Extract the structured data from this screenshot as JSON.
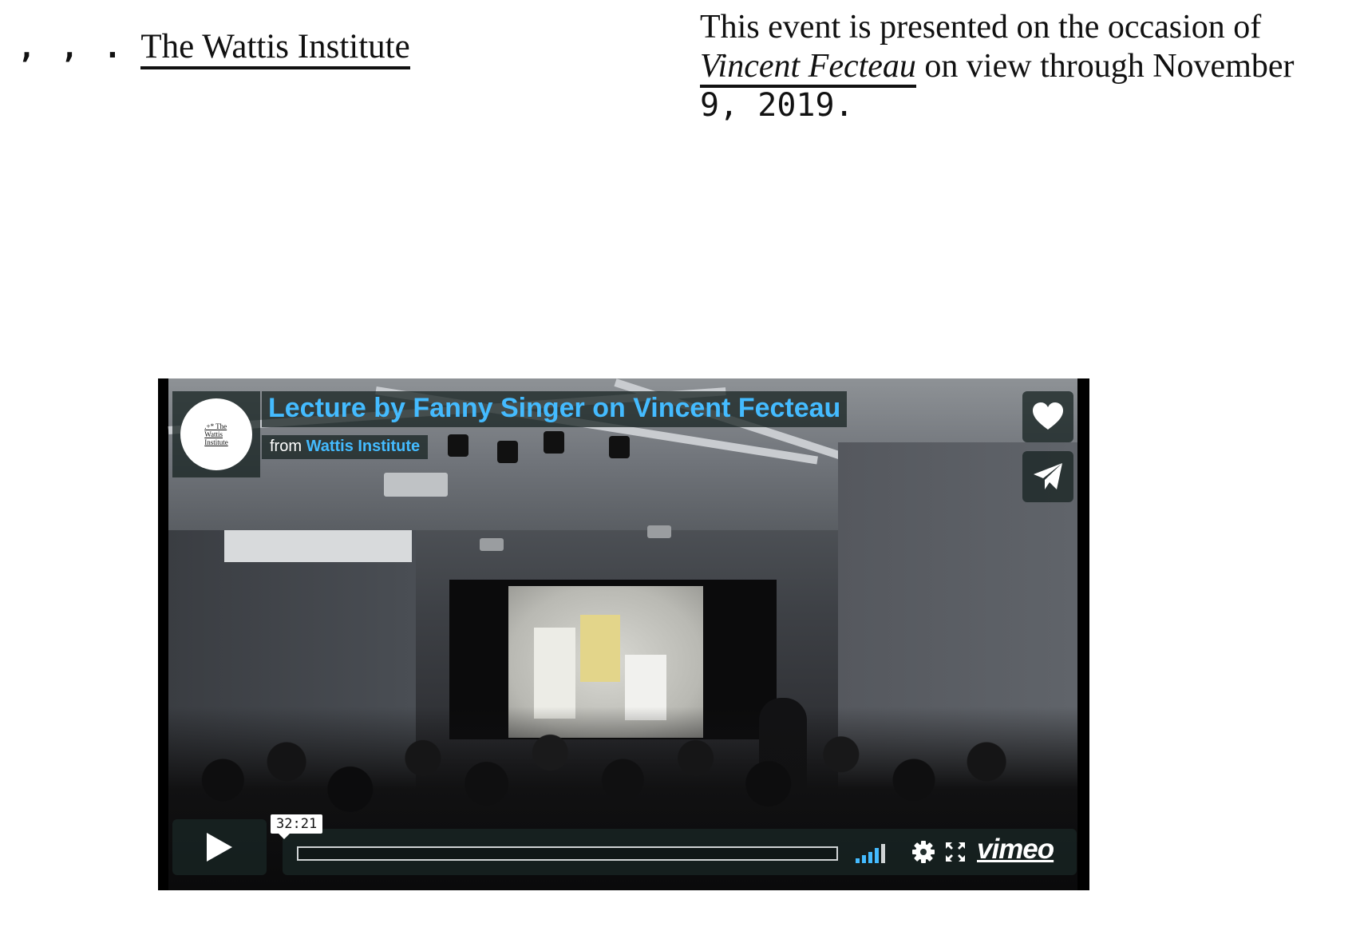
{
  "header": {
    "nav_dots": ", , .",
    "site_name": "The Wattis Institute"
  },
  "event_note": {
    "text_before": "This event is presented on the occasion of ",
    "exhibition_title": "Vincent Fecteau",
    "text_after": " on view through November ",
    "date_mono": "9, 2019."
  },
  "video": {
    "title": "Lecture by Fanny Singer on Vincent Fecteau",
    "byline_prefix": "from ",
    "channel": "Wattis Institute",
    "portrait_text": [
      ".+* The",
      "Wattis",
      "Institute"
    ],
    "time_tooltip": "32:21",
    "logo": "vimeo",
    "icons": {
      "like": "heart-icon",
      "share": "paper-plane-icon",
      "play": "play-icon",
      "volume": "volume-icon",
      "settings": "gear-icon",
      "fullscreen": "fullscreen-icon"
    },
    "colors": {
      "accent": "#44bbff",
      "overlay": "#172322"
    }
  }
}
